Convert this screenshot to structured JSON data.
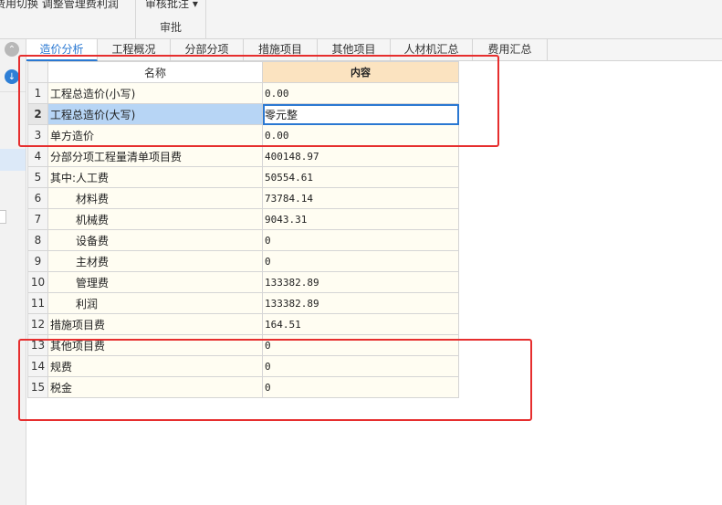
{
  "toolbar": {
    "cut_text": "费用切换   调整管理费利润",
    "review_button": "审核批注 ▾",
    "review_group": "审批"
  },
  "left_panel": {
    "collapse_icon": "chevron-up-icon",
    "download_icon": "arrow-down-circle-icon"
  },
  "tabs": [
    {
      "label": "造价分析"
    },
    {
      "label": "工程概况"
    },
    {
      "label": "分部分项"
    },
    {
      "label": "措施项目"
    },
    {
      "label": "其他项目"
    },
    {
      "label": "人材机汇总"
    },
    {
      "label": "费用汇总"
    }
  ],
  "grid": {
    "headers": {
      "name": "名称",
      "value": "内容"
    },
    "rows": [
      {
        "no": "1",
        "name": "工程总造价(小写)",
        "value": "0.00"
      },
      {
        "no": "2",
        "name": "工程总造价(大写)",
        "value": "零元整"
      },
      {
        "no": "3",
        "name": "单方造价",
        "value": "0.00"
      },
      {
        "no": "4",
        "name": "分部分项工程量清单项目费",
        "value": "400148.97"
      },
      {
        "no": "5",
        "name": "其中:人工费",
        "value": "50554.61"
      },
      {
        "no": "6",
        "name": "材料费",
        "value": "73784.14"
      },
      {
        "no": "7",
        "name": "机械费",
        "value": "9043.31"
      },
      {
        "no": "8",
        "name": "设备费",
        "value": "0"
      },
      {
        "no": "9",
        "name": "主材费",
        "value": "0"
      },
      {
        "no": "10",
        "name": "管理费",
        "value": "133382.89"
      },
      {
        "no": "11",
        "name": "利润",
        "value": "133382.89"
      },
      {
        "no": "12",
        "name": "措施项目费",
        "value": "164.51"
      },
      {
        "no": "13",
        "name": "其他项目费",
        "value": "0"
      },
      {
        "no": "14",
        "name": "规费",
        "value": "0"
      },
      {
        "no": "15",
        "name": "税金",
        "value": "0"
      }
    ]
  },
  "colors": {
    "accent": "#2a78d2",
    "annotation_red": "#e62e2e",
    "header_value_bg": "#fbe3c0",
    "cell_bg": "#fffdf2"
  }
}
